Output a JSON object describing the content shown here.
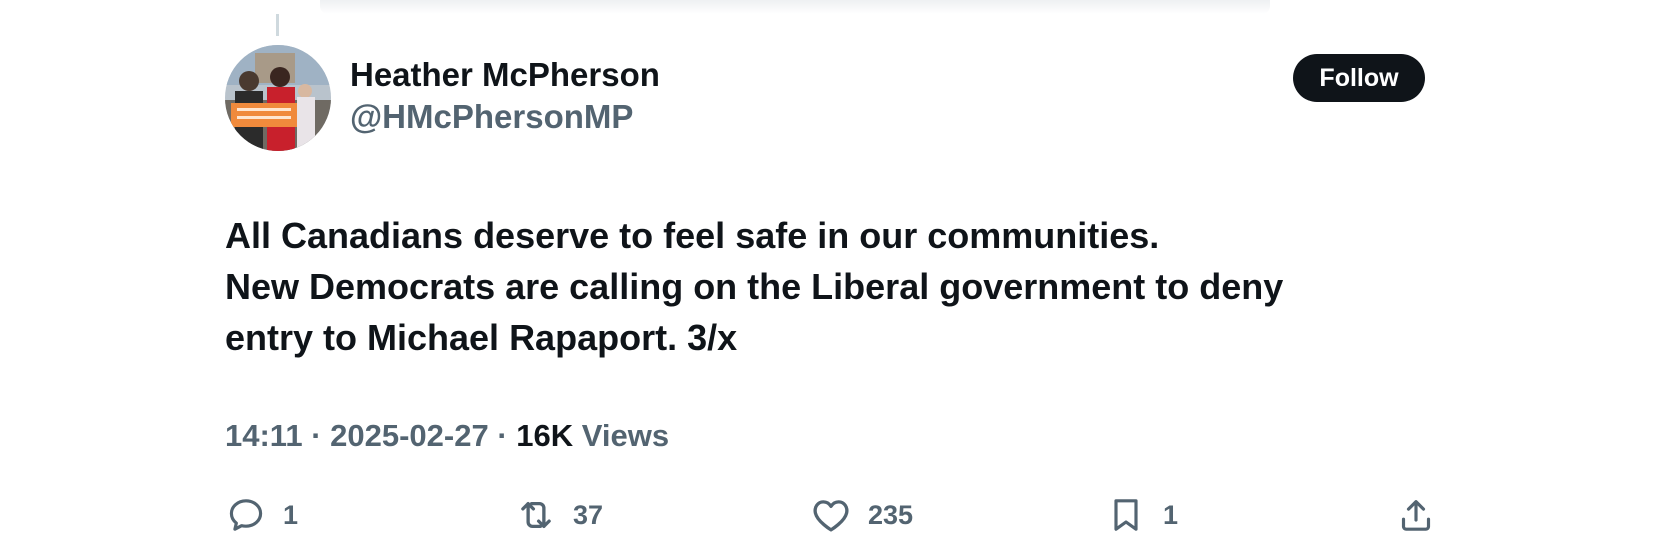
{
  "author": {
    "name": "Heather McPherson",
    "handle": "@HMcPhersonMP"
  },
  "follow_label": "Follow",
  "tweet": {
    "lines": [
      "All Canadians deserve to feel safe in our communities.",
      "New Democrats are calling on the Liberal government to deny",
      "entry to Michael Rapaport. 3/x"
    ]
  },
  "meta": {
    "time": "14:11",
    "separator": " · ",
    "date": "2025-02-27",
    "views_count": "16K",
    "views_label": "Views"
  },
  "actions": {
    "reply": {
      "icon": "reply-icon",
      "count": "1"
    },
    "repost": {
      "icon": "repost-icon",
      "count": "37"
    },
    "like": {
      "icon": "heart-icon",
      "count": "235"
    },
    "bookmark": {
      "icon": "bookmark-icon",
      "count": "1"
    },
    "share": {
      "icon": "share-icon"
    }
  },
  "colors": {
    "text_primary": "#0f1419",
    "text_secondary": "#536471",
    "follow_bg": "#0f1419"
  }
}
